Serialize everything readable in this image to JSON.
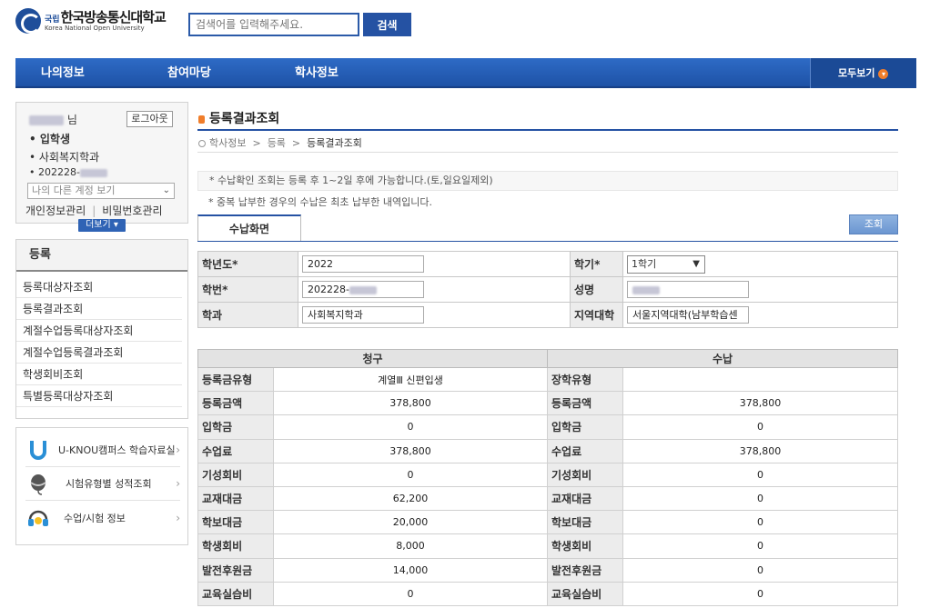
{
  "header": {
    "logo_prefix": "국립",
    "logo_ko": "한국방송통신대학교",
    "logo_en": "Korea National Open University",
    "search_placeholder": "검색어를 입력해주세요.",
    "search_label": "검색"
  },
  "gnb": {
    "items": [
      "나의정보",
      "참여마당",
      "학사정보"
    ],
    "all_label": "모두보기"
  },
  "user": {
    "suffix": "님",
    "logout_label": "로그아웃",
    "status": "입학생",
    "department": "사회복지학과",
    "student_id_prefix": "202228-",
    "account_select": "나의 다른 계정 보기",
    "link_privacy": "개인정보관리",
    "link_password": "비밀번호관리",
    "more_label": "더보기"
  },
  "lnb": {
    "title": "등록",
    "items": [
      "등록대상자조회",
      "등록결과조회",
      "계절수업등록대상자조회",
      "계절수업등록결과조회",
      "학생회비조회",
      "특별등록대상자조회"
    ]
  },
  "banners": [
    {
      "label": "U-KNOU캠퍼스 학습자료실",
      "icon": "u-knou-logo-icon"
    },
    {
      "label": "시험유형별 성적조회",
      "icon": "mouse-icon"
    },
    {
      "label": "수업/시험 정보",
      "icon": "headset-icon"
    }
  ],
  "main": {
    "title": "등록결과조회",
    "breadcrumb": [
      "학사정보",
      "등록",
      "등록결과조회"
    ],
    "notice1": "* 수납확인 조회는 등록 후 1~2일 후에 가능합니다.(토,일요일제외)",
    "notice2": "* 중복 납부한 경우의 수납은 최초 납부한 내역입니다.",
    "tab_label": "수납화면",
    "query_label": "조회"
  },
  "form": {
    "year_label": "학년도",
    "year_value": "2022",
    "semester_label": "학기",
    "semester_value": "1학기",
    "student_id_label": "학번",
    "student_id_value": "202228-",
    "name_label": "성명",
    "dept_label": "학과",
    "dept_value": "사회복지학과",
    "region_label": "지역대학",
    "region_value": "서울지역대학(남부학습센",
    "required_mark": "*"
  },
  "payment": {
    "bill_header": "청구",
    "paid_header": "수납",
    "rows": [
      {
        "bill_label": "등록금유형",
        "bill_value": "계열Ⅲ 신편입생",
        "paid_label": "장학유형",
        "paid_value": ""
      },
      {
        "bill_label": "등록금액",
        "bill_value": "378,800",
        "paid_label": "등록금액",
        "paid_value": "378,800"
      },
      {
        "bill_label": "입학금",
        "bill_value": "0",
        "paid_label": "입학금",
        "paid_value": "0"
      },
      {
        "bill_label": "수업료",
        "bill_value": "378,800",
        "paid_label": "수업료",
        "paid_value": "378,800"
      },
      {
        "bill_label": "기성회비",
        "bill_value": "0",
        "paid_label": "기성회비",
        "paid_value": "0"
      },
      {
        "bill_label": "교재대금",
        "bill_value": "62,200",
        "paid_label": "교재대금",
        "paid_value": "0"
      },
      {
        "bill_label": "학보대금",
        "bill_value": "20,000",
        "paid_label": "학보대금",
        "paid_value": "0"
      },
      {
        "bill_label": "학생회비",
        "bill_value": "8,000",
        "paid_label": "학생회비",
        "paid_value": "0"
      },
      {
        "bill_label": "발전후원금",
        "bill_value": "14,000",
        "paid_label": "발전후원금",
        "paid_value": "0"
      },
      {
        "bill_label": "교육실습비",
        "bill_value": "0",
        "paid_label": "교육실습비",
        "paid_value": "0"
      }
    ]
  },
  "colors": {
    "primary": "#2552a3",
    "accent": "#f07d2a"
  }
}
